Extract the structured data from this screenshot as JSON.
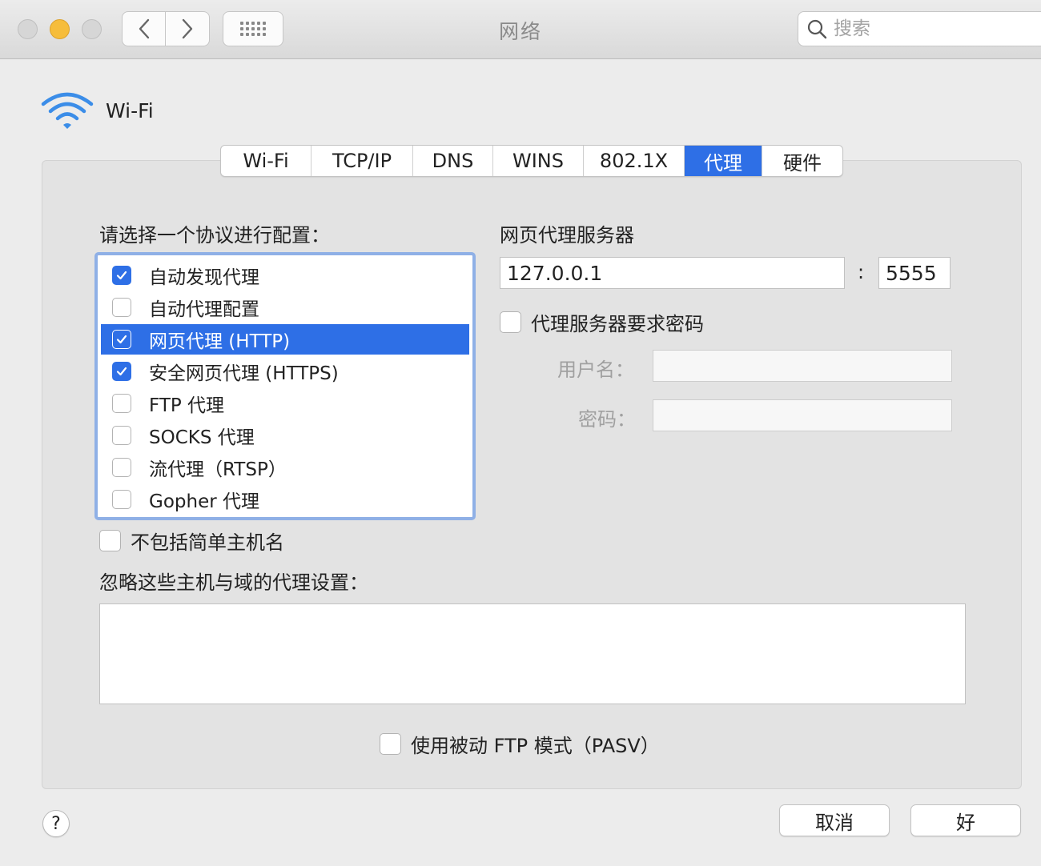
{
  "window": {
    "title": "网络",
    "search_placeholder": "搜索"
  },
  "interface": {
    "name": "Wi-Fi"
  },
  "tabs": [
    {
      "label": "Wi-Fi",
      "active": false
    },
    {
      "label": "TCP/IP",
      "active": false
    },
    {
      "label": "DNS",
      "active": false
    },
    {
      "label": "WINS",
      "active": false
    },
    {
      "label": "802.1X",
      "active": false
    },
    {
      "label": "代理",
      "active": true
    },
    {
      "label": "硬件",
      "active": false
    }
  ],
  "protocol_section": {
    "label": "请选择一个协议进行配置：",
    "items": [
      {
        "label": "自动发现代理",
        "checked": true,
        "selected": false
      },
      {
        "label": "自动代理配置",
        "checked": false,
        "selected": false
      },
      {
        "label": "网页代理 (HTTP)",
        "checked": true,
        "selected": true
      },
      {
        "label": "安全网页代理 (HTTPS)",
        "checked": true,
        "selected": false
      },
      {
        "label": "FTP 代理",
        "checked": false,
        "selected": false
      },
      {
        "label": "SOCKS 代理",
        "checked": false,
        "selected": false
      },
      {
        "label": "流代理（RTSP）",
        "checked": false,
        "selected": false
      },
      {
        "label": "Gopher 代理",
        "checked": false,
        "selected": false
      }
    ]
  },
  "proxy_server": {
    "label": "网页代理服务器",
    "host": "127.0.0.1",
    "colon": ":",
    "port": "5555",
    "requires_password_label": "代理服务器要求密码",
    "requires_password": false,
    "username_label": "用户名：",
    "password_label": "密码："
  },
  "exclude_simple_hostnames": {
    "label": "不包括简单主机名",
    "checked": false
  },
  "bypass": {
    "label": "忽略这些主机与域的代理设置："
  },
  "passive_ftp": {
    "label": "使用被动 FTP 模式（PASV）",
    "checked": false
  },
  "buttons": {
    "help": "?",
    "cancel": "取消",
    "ok": "好"
  },
  "colors": {
    "accent": "#2e6fe6",
    "focus_ring": "#8fb0e6",
    "wifi_icon": "#3b8de8",
    "traffic_yellow": "#f6bd3b"
  }
}
